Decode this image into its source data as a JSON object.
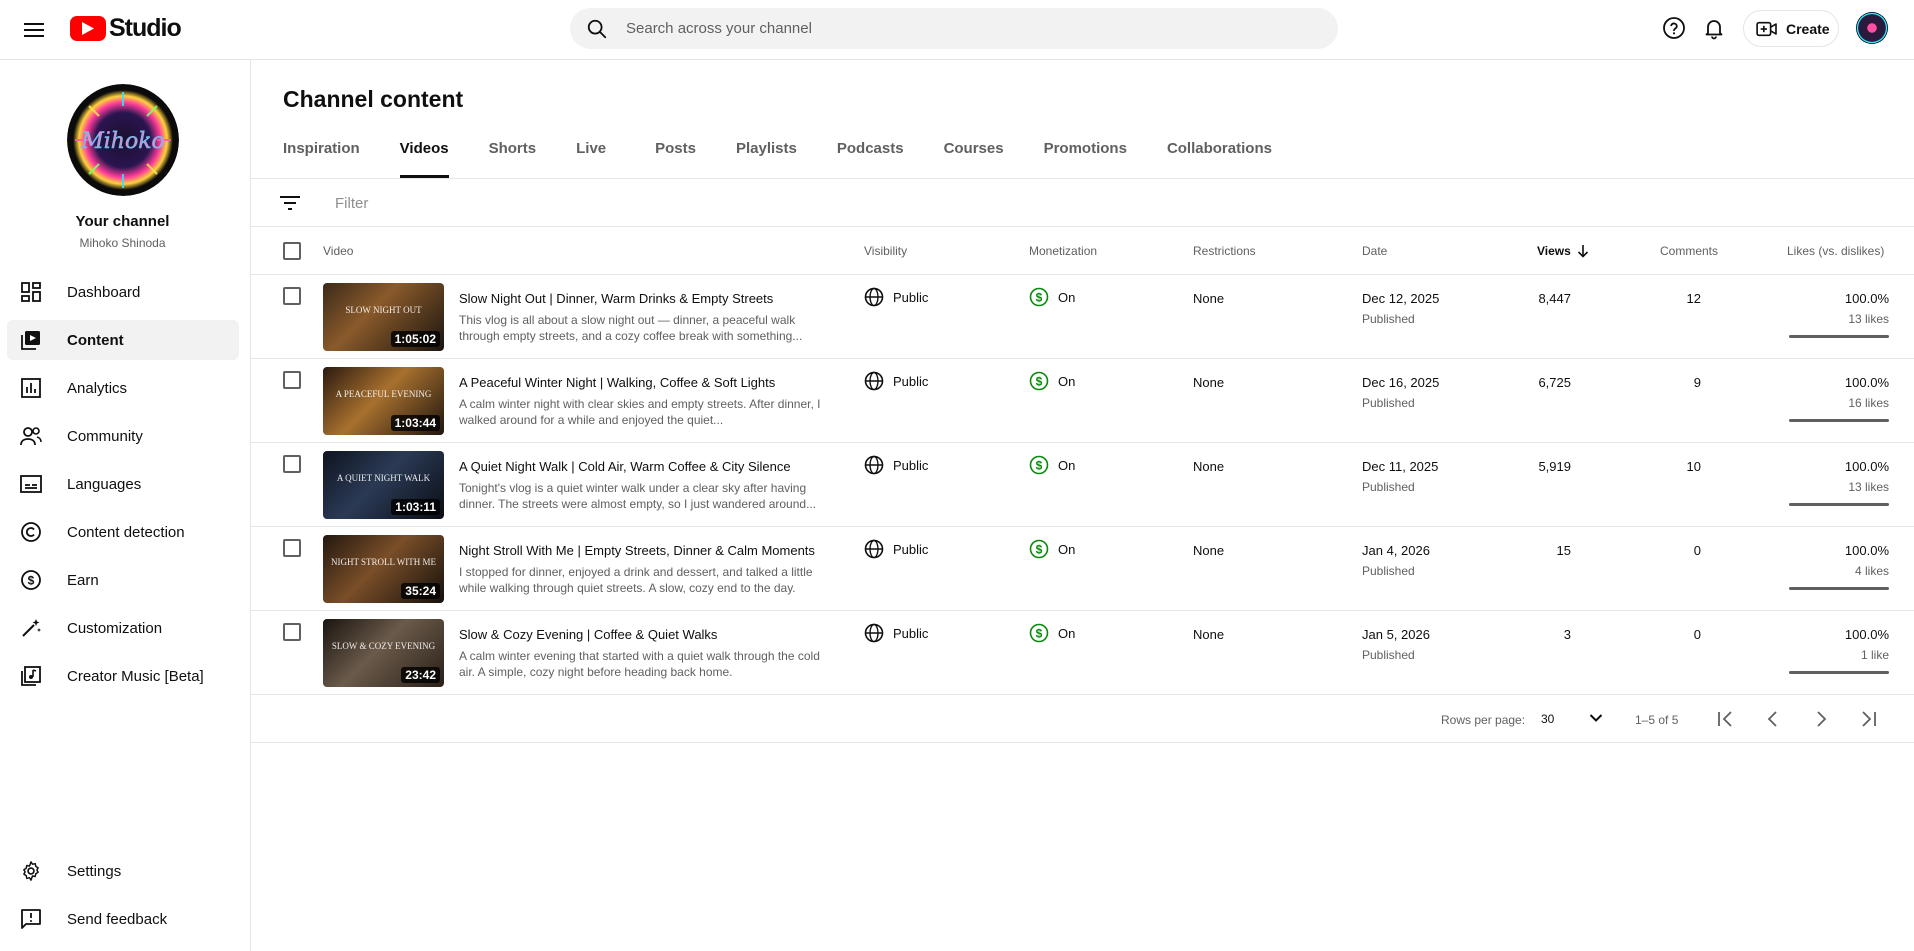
{
  "app": {
    "logo_text": "Studio"
  },
  "header": {
    "search_placeholder": "Search across your channel",
    "create_label": "Create"
  },
  "sidebar": {
    "channel_title": "Your channel",
    "channel_name": "Mihoko Shinoda",
    "avatar_text": "Mihoko",
    "items": [
      {
        "label": "Dashboard",
        "icon": "dashboard-icon"
      },
      {
        "label": "Content",
        "icon": "content-icon",
        "active": true
      },
      {
        "label": "Analytics",
        "icon": "analytics-icon"
      },
      {
        "label": "Community",
        "icon": "community-icon"
      },
      {
        "label": "Languages",
        "icon": "subtitles-icon"
      },
      {
        "label": "Content detection",
        "icon": "copyright-icon"
      },
      {
        "label": "Earn",
        "icon": "dollar-icon"
      },
      {
        "label": "Customization",
        "icon": "magic-wand-icon"
      },
      {
        "label": "Creator Music [Beta]",
        "icon": "music-library-icon"
      }
    ],
    "bottom_items": [
      {
        "label": "Settings",
        "icon": "gear-icon"
      },
      {
        "label": "Send feedback",
        "icon": "feedback-icon"
      }
    ]
  },
  "main": {
    "title": "Channel content",
    "tabs": [
      {
        "label": "Inspiration"
      },
      {
        "label": "Videos",
        "active": true
      },
      {
        "label": "Shorts"
      },
      {
        "label": "Live"
      },
      {
        "label": "Posts"
      },
      {
        "label": "Playlists"
      },
      {
        "label": "Podcasts"
      },
      {
        "label": "Courses"
      },
      {
        "label": "Promotions"
      },
      {
        "label": "Collaborations"
      }
    ],
    "filter_placeholder": "Filter",
    "columns": {
      "video": "Video",
      "visibility": "Visibility",
      "monetization": "Monetization",
      "restrictions": "Restrictions",
      "date": "Date",
      "views": "Views",
      "comments": "Comments",
      "likes": "Likes (vs. dislikes)"
    },
    "rows": [
      {
        "title": "Slow Night Out | Dinner, Warm Drinks & Empty Streets",
        "description": "This vlog is all about a slow night out — dinner, a peaceful walk through empty streets, and a cozy coffee break with something...",
        "duration": "1:05:02",
        "thumb_text": "SLOW NIGHT OUT",
        "visibility": "Public",
        "monetization": "On",
        "restrictions": "None",
        "date": "Dec 12, 2025",
        "status": "Published",
        "views": "8,447",
        "comments": "12",
        "likes_pct": "100.0%",
        "likes_count": "13 likes",
        "likes_ratio": 1.0
      },
      {
        "title": "A Peaceful Winter Night | Walking, Coffee & Soft Lights",
        "description": "A calm winter night with clear skies and empty streets. After dinner, I walked around for a while and enjoyed the quiet...",
        "duration": "1:03:44",
        "thumb_text": "A PEACEFUL EVENING",
        "visibility": "Public",
        "monetization": "On",
        "restrictions": "None",
        "date": "Dec 16, 2025",
        "status": "Published",
        "views": "6,725",
        "comments": "9",
        "likes_pct": "100.0%",
        "likes_count": "16 likes",
        "likes_ratio": 1.0
      },
      {
        "title": "A Quiet Night Walk | Cold Air, Warm Coffee & City Silence",
        "description": "Tonight's vlog is a quiet winter walk under a clear sky after having dinner. The streets were almost empty, so I just wandered around...",
        "duration": "1:03:11",
        "thumb_text": "A QUIET NIGHT WALK",
        "visibility": "Public",
        "monetization": "On",
        "restrictions": "None",
        "date": "Dec 11, 2025",
        "status": "Published",
        "views": "5,919",
        "comments": "10",
        "likes_pct": "100.0%",
        "likes_count": "13 likes",
        "likes_ratio": 1.0
      },
      {
        "title": "Night Stroll With Me | Empty Streets, Dinner & Calm Moments",
        "description": "I stopped for dinner, enjoyed a drink and dessert, and talked a little while walking through quiet streets. A slow, cozy end to the day.",
        "duration": "35:24",
        "thumb_text": "NIGHT STROLL WITH ME",
        "visibility": "Public",
        "monetization": "On",
        "restrictions": "None",
        "date": "Jan 4, 2026",
        "status": "Published",
        "views": "15",
        "comments": "0",
        "likes_pct": "100.0%",
        "likes_count": "4 likes",
        "likes_ratio": 1.0
      },
      {
        "title": "Slow & Cozy Evening | Coffee & Quiet Walks",
        "description": "A calm winter evening that started with a quiet walk through the cold air. A simple, cozy night before heading back home.",
        "duration": "23:42",
        "thumb_text": "SLOW & COZY EVENING",
        "visibility": "Public",
        "monetization": "On",
        "restrictions": "None",
        "date": "Jan 5, 2026",
        "status": "Published",
        "views": "3",
        "comments": "0",
        "likes_pct": "100.0%",
        "likes_count": "1 like",
        "likes_ratio": 1.0
      }
    ],
    "pagination": {
      "rows_per_page_label": "Rows per page:",
      "rows_per_page_value": "30",
      "range": "1–5 of 5"
    }
  },
  "colors": {
    "brand_red": "#ff0000",
    "monetization_green": "#0a8a0a",
    "active_bg": "#f2f2f2",
    "text_secondary": "#606060"
  }
}
